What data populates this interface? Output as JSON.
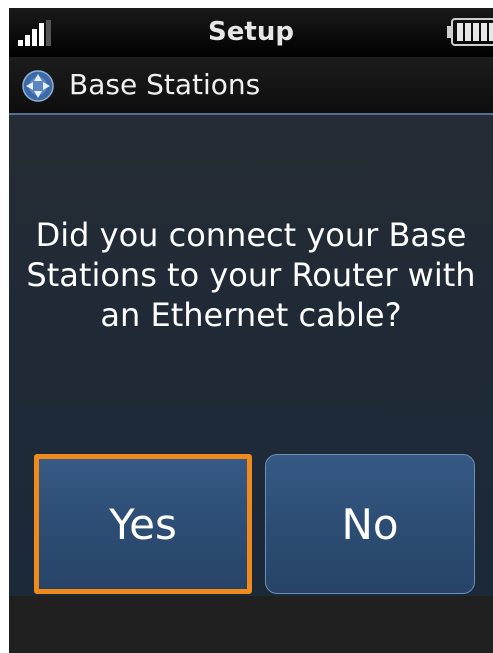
{
  "status_bar": {
    "title": "Setup",
    "signal_icon": "signal-strength-icon",
    "battery_icon": "battery-icon"
  },
  "header": {
    "icon": "base-station-icon",
    "label": "Base Stations"
  },
  "dialog": {
    "question": "Did you connect your Base Stations to your Router with an Ethernet cable?",
    "yes_label": "Yes",
    "no_label": "No"
  },
  "colors": {
    "accent_focus": "#f08a1c",
    "button_blue": "#2d4d74",
    "background": "#000000"
  }
}
